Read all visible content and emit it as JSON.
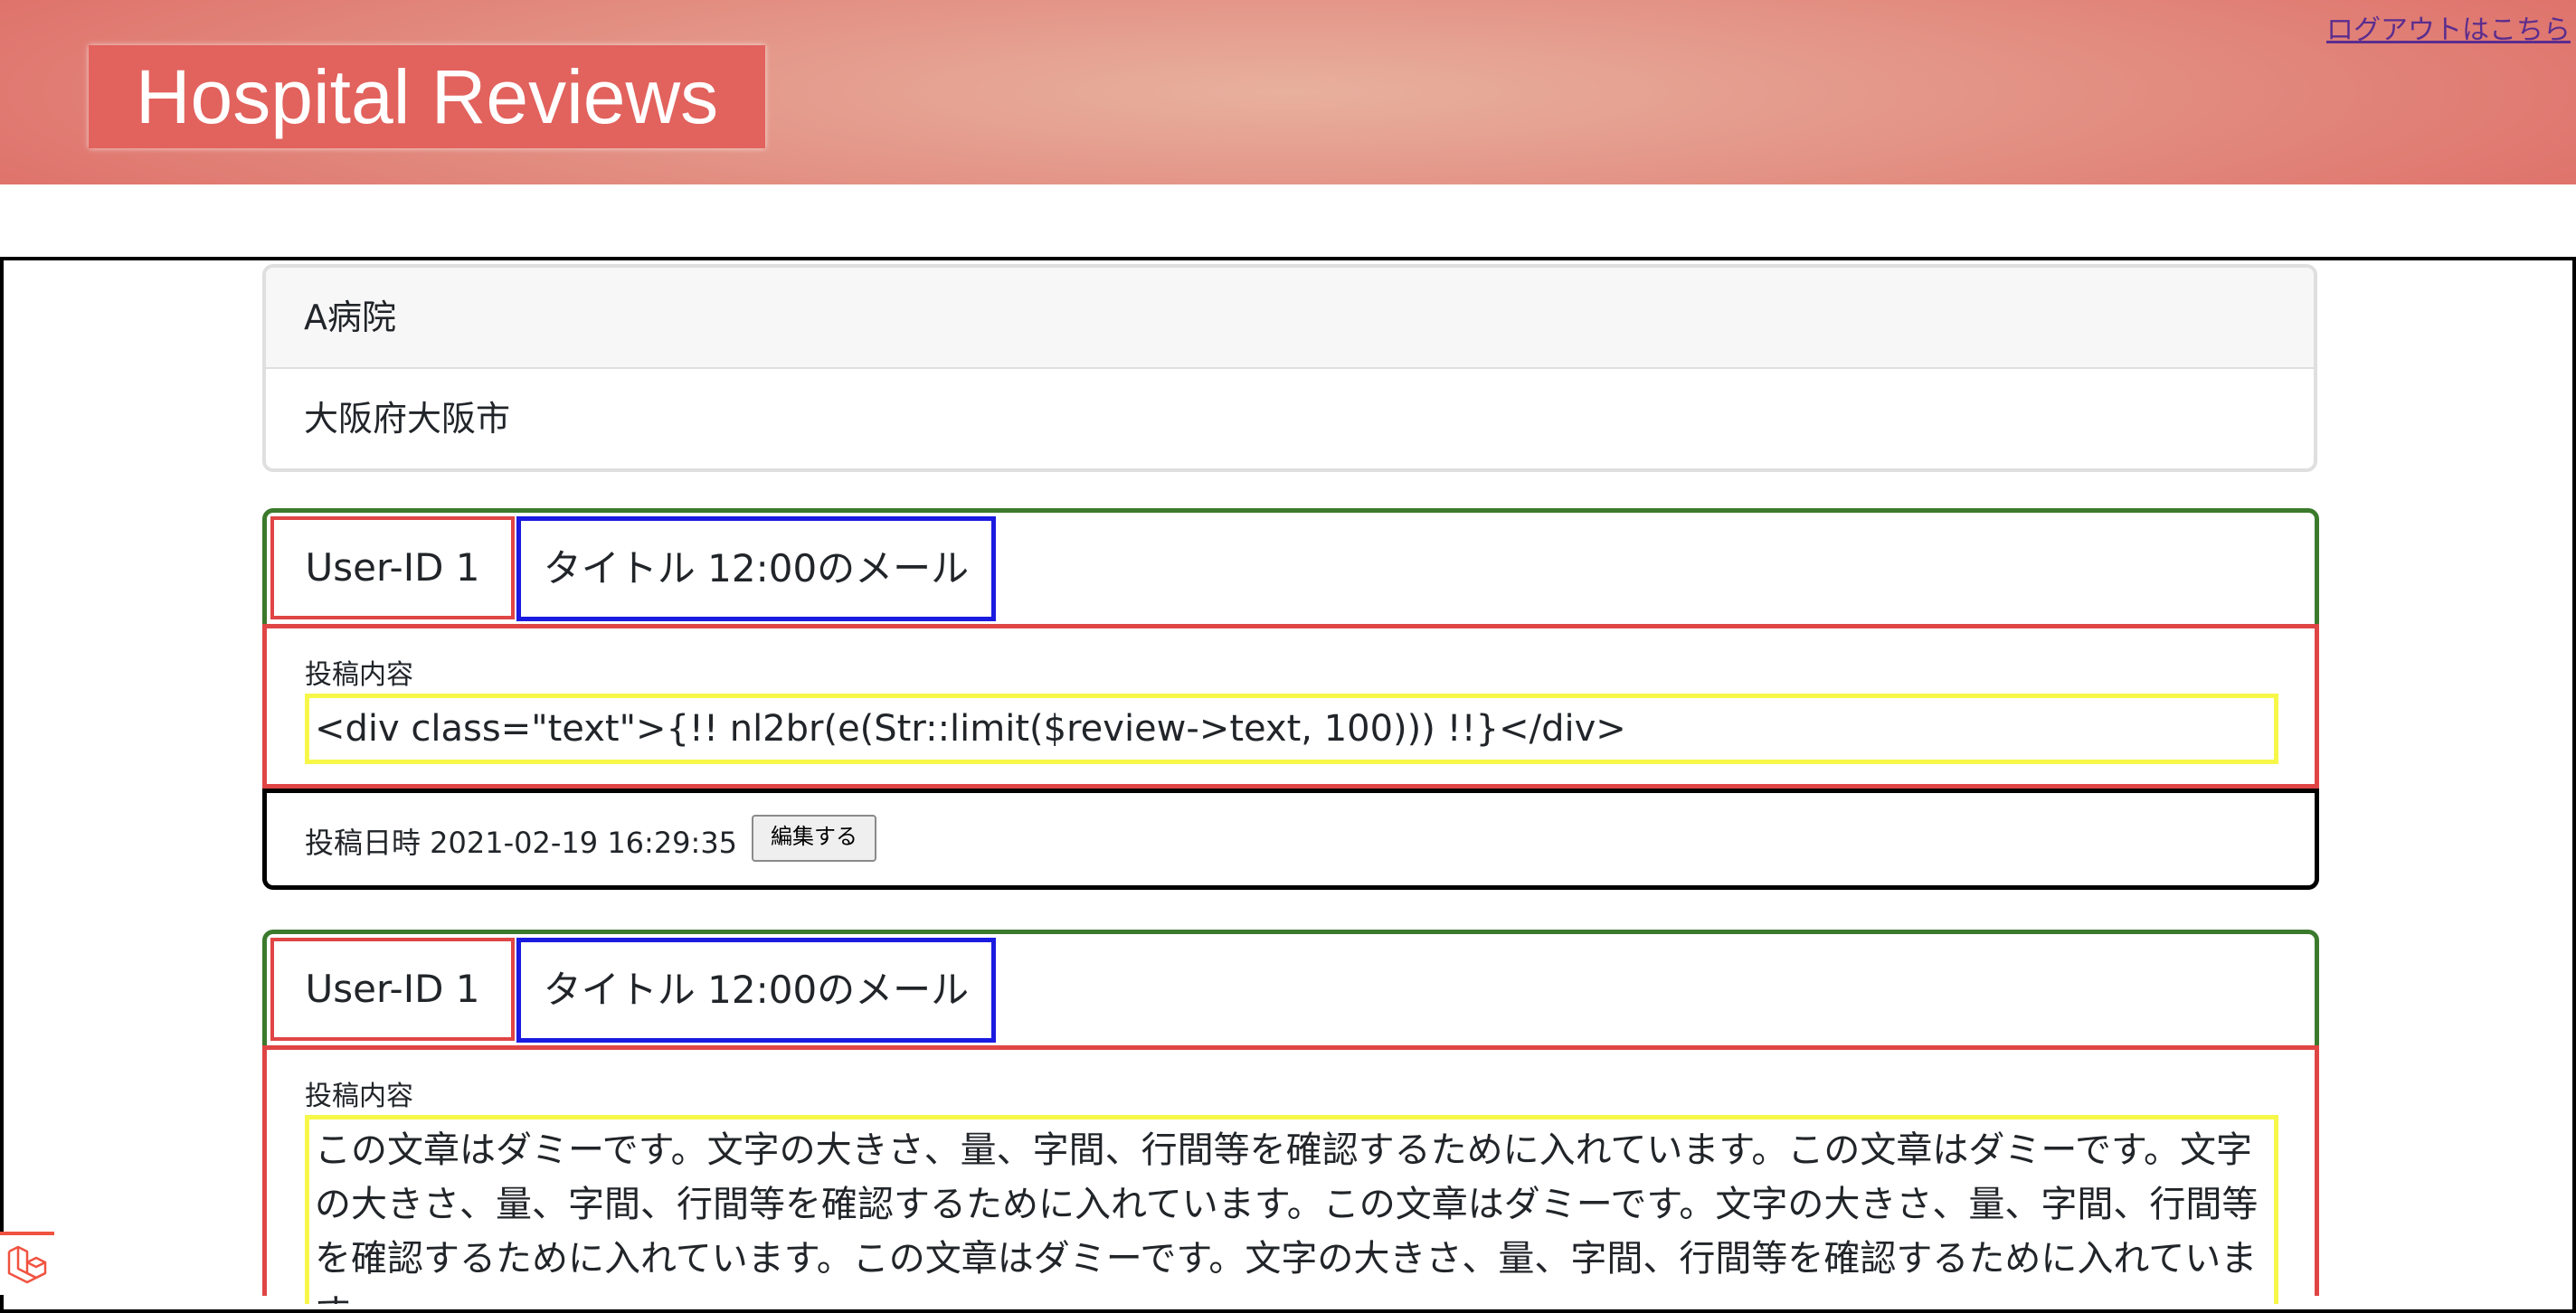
{
  "header": {
    "title": "Hospital Reviews",
    "logout_link": "ログアウトはこちら"
  },
  "hospital": {
    "name": "A病院",
    "address": "大阪府大阪市"
  },
  "reviews": [
    {
      "user_id": "User-ID 1",
      "title": "タイトル 12:00のメール",
      "body_label": "投稿内容",
      "body_text": "<div class=\"text\">{!! nl2br(e(Str::limit($review->text, 100))) !!}</div>",
      "posted_at": "投稿日時 2021-02-19 16:29:35",
      "edit_label": "編集する"
    },
    {
      "user_id": "User-ID 1",
      "title": "タイトル 12:00のメール",
      "body_label": "投稿内容",
      "body_text": "この文章はダミーです。文字の大きさ、量、字間、行間等を確認するために入れています。この文章はダミーです。文字の大きさ、量、字間、行間等を確認するために入れています。この文章はダミーです。文字の大きさ、量、字間、行間等を確認するために入れています。この文章はダミーです。文字の大きさ、量、字間、行間等を確認するために入れています。"
    }
  ],
  "colors": {
    "header_gradient_center": "#e8b09e",
    "header_gradient_edge": "#de6e68",
    "brand_bg": "#e2625d",
    "review_head_border": "#3b7a2c",
    "user_id_border": "#e04545",
    "title_border": "#1a1ae0",
    "body_border": "#e04545",
    "body_text_border": "#f7f74a",
    "logout_link": "#5b2d8e"
  },
  "icons": {
    "badge": "laravel-logo-icon"
  }
}
